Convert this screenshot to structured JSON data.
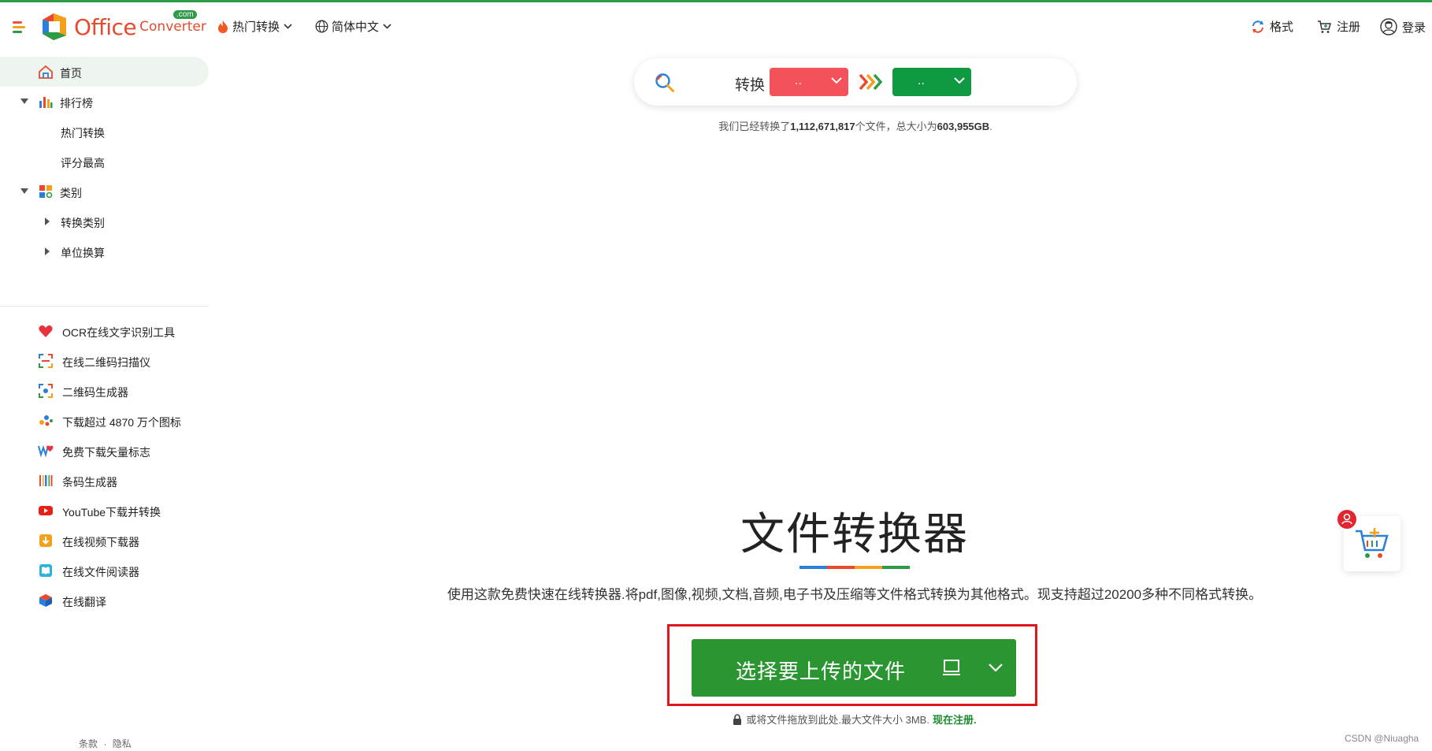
{
  "header": {
    "logo_text": "Office",
    "logo_sub": "Converter",
    "logo_com": ".com",
    "hot_label": "热门转换",
    "lang_label": "简体中文",
    "format_label": "格式",
    "register_label": "注册",
    "login_label": "登录"
  },
  "sidebar": {
    "home": "首页",
    "ranking": "排行榜",
    "hot_convert": "热门转换",
    "top_rated": "评分最高",
    "category": "类别",
    "convert_category": "转换类别",
    "unit_convert": "单位换算",
    "tools": [
      "OCR在线文字识别工具",
      "在线二维码扫描仪",
      "二维码生成器",
      "下载超过 4870 万个图标",
      "免费下载矢量标志",
      "条码生成器",
      "YouTube下载并转换",
      "在线视频下载器",
      "在线文件阅读器",
      "在线翻译"
    ],
    "footer_terms": "条款",
    "footer_sep": "·",
    "footer_privacy": "隐私"
  },
  "search": {
    "convert_label": "转换",
    "from_value": "..",
    "to_value": ".."
  },
  "stats": {
    "prefix": "我们已经转换了",
    "files": "1,112,671,817",
    "middle": "个文件，总大小为",
    "size": "603,955GB",
    "suffix": "."
  },
  "hero": {
    "title": "文件转换器",
    "description": "使用这款免费快速在线转换器.将pdf,图像,视频,文档,音频,电子书及压缩等文件格式转换为其他格式。现支持超过20200多种不同格式转换。",
    "upload_label": "选择要上传的文件",
    "drop_note": "或将文件拖放到此处.最大文件大小 3MB.",
    "register_now": "现在注册."
  },
  "watermark": "CSDN @Niuagha",
  "colors": {
    "brand_green": "#2a9531",
    "from_red": "#f4525a",
    "to_green": "#0f9942",
    "highlight_red": "#e0161d"
  }
}
